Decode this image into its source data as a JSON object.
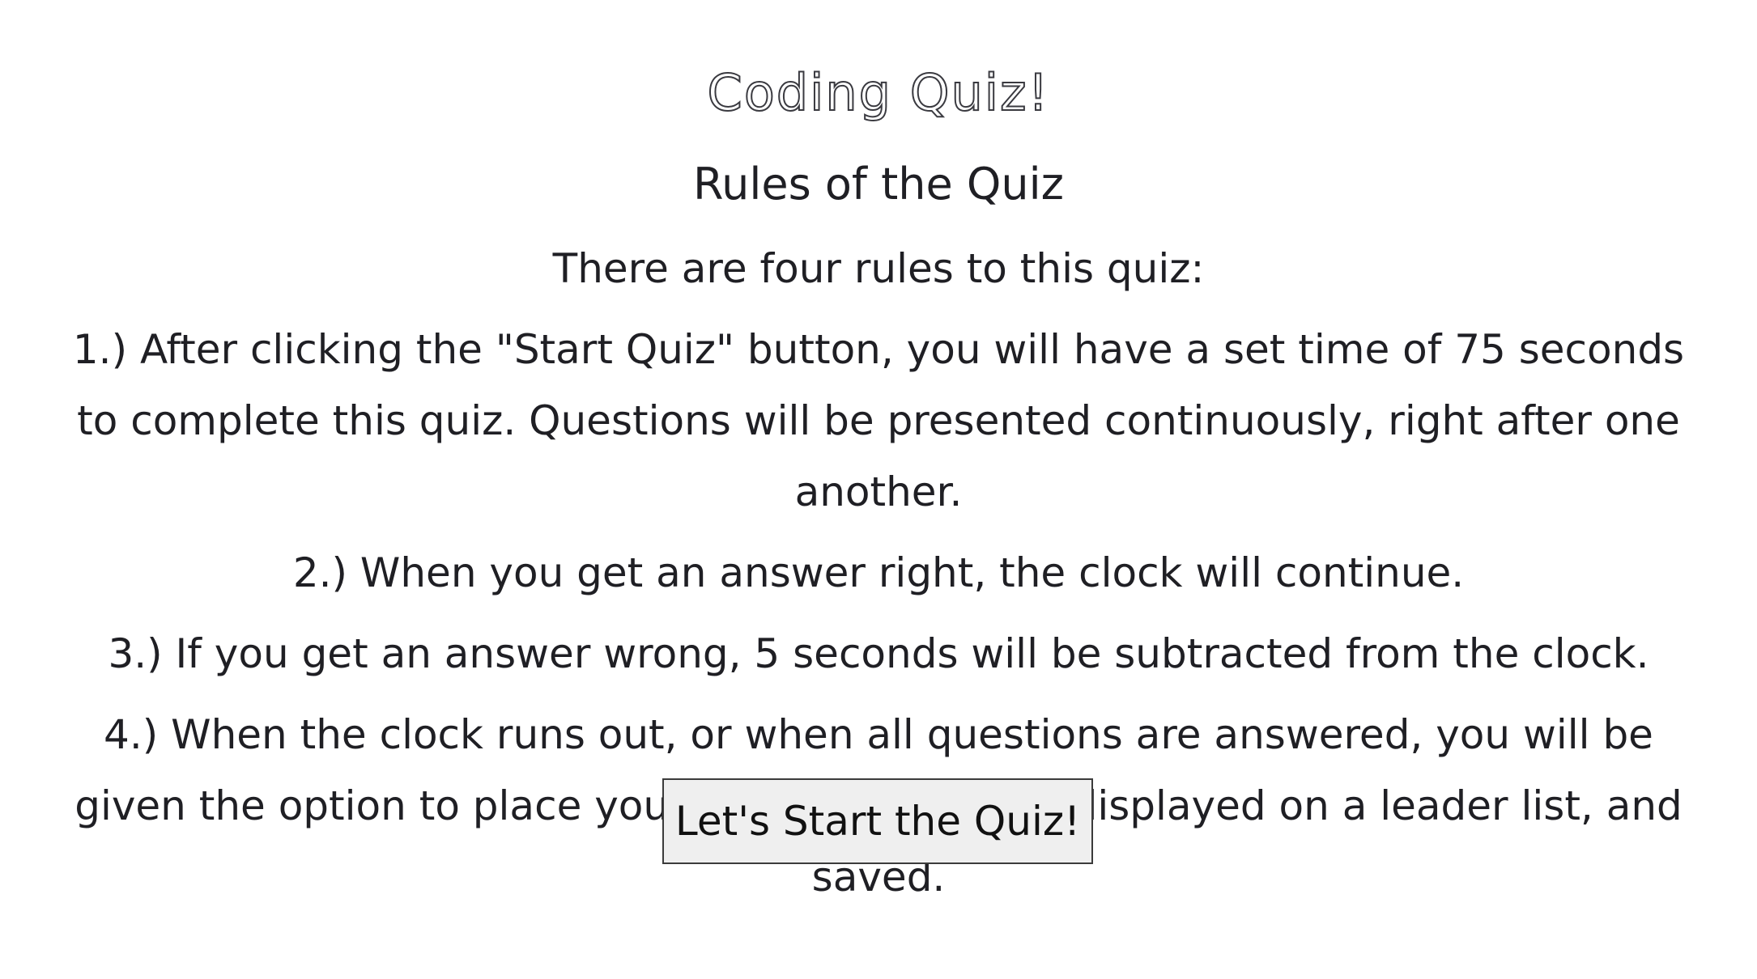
{
  "header": {
    "title": "Coding Quiz!"
  },
  "rules": {
    "heading": "Rules of the Quiz",
    "intro": "There are four rules to this quiz:",
    "items": [
      "1.) After clicking the \"Start Quiz\" button, you will have a set time of 75 seconds to complete this quiz. Questions will be presented continuously, right after one another.",
      "2.) When you get an answer right, the clock will continue.",
      "3.) If you get an answer wrong, 5 seconds will be subtracted from the clock.",
      "4.) When the clock runs out, or when all questions are answered, you will be given the option to place your score. This will be displayed on a leader list, and saved."
    ]
  },
  "actions": {
    "start_label": "Let's Start the Quiz!"
  },
  "colors": {
    "text": "#1f1f24",
    "button_bg": "#efefef",
    "button_border": "#3b3b3b",
    "background": "#ffffff"
  }
}
